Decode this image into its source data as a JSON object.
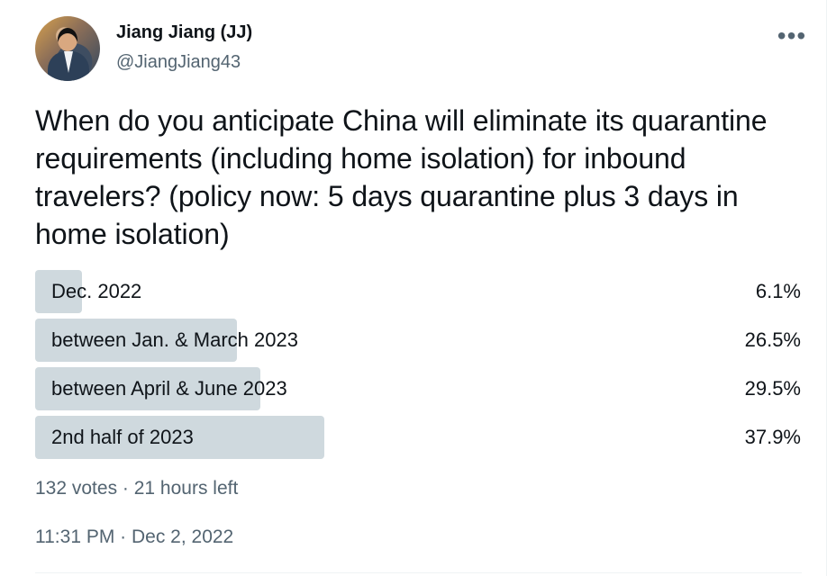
{
  "author": {
    "name": "Jiang Jiang (JJ)",
    "handle": "@JiangJiang43",
    "avatar_icon": "profile-photo"
  },
  "menu": {
    "more_icon": "•••"
  },
  "tweet": {
    "question": "When do you anticipate China will eliminate its quarantine requirements (including home isolation) for inbound travelers? (policy now: 5 days quarantine plus 3 days in home isolation)"
  },
  "poll": {
    "options": [
      {
        "label": "Dec. 2022",
        "percent": "6.1%",
        "value": 0.061
      },
      {
        "label": "between Jan. & March 2023",
        "percent": "26.5%",
        "value": 0.265
      },
      {
        "label": "between April & June 2023",
        "percent": "29.5%",
        "value": 0.295
      },
      {
        "label": "2nd half of 2023",
        "percent": "37.9%",
        "value": 0.379
      }
    ],
    "meta": "132 votes · 21 hours left"
  },
  "footer": {
    "timestamp": "11:31 PM · Dec 2, 2022"
  },
  "colors": {
    "text": "#0f1419",
    "secondary_text": "#536471",
    "poll_fill": "#cfd9de",
    "divider": "#eff3f4"
  }
}
